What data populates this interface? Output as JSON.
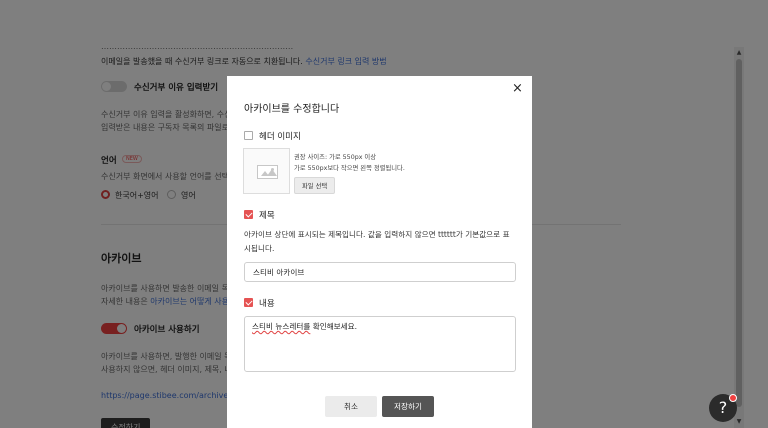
{
  "page": {
    "line_a": "이메일을 발송했을 때 수신거부 링크로 자동으로 치환됩니다.",
    "link_a": "수신거부 링크 입력 방법",
    "unsub_toggle_label": "수신거부 이유 입력받기",
    "unsub_desc_1": "수신거부 이유 입력을 활성화하면, 수신",
    "unsub_desc_2": "입력받은 내용은 구독자 목록의 파일로",
    "lang_heading": "언어",
    "new_badge": "NEW",
    "lang_desc": "수신거부 화면에서 사용할 언어를 선택",
    "lang_opt_1": "한국어+영어",
    "lang_opt_2": "영어",
    "archive_heading": "아카이브",
    "archive_desc_1": "아카이브를 사용하면 발송한 이메일 목",
    "archive_desc_2_pre": "자세한 내용은 ",
    "archive_desc_2_link": "아카이브는 어떻게 사용",
    "archive_toggle_label": "아카이브 사용하기",
    "archive_use_1": "아카이브를 사용하면, 발행한 이메일 목",
    "archive_use_2": "사용하지 않으면, 헤더 이미지, 제목, 내",
    "archive_url": "https://page.stibee.com/archive",
    "edit_button": "수정하기"
  },
  "modal": {
    "title": "아카이브를 수정합니다",
    "close_glyph": "×",
    "header_image": {
      "label": "헤더 이미지",
      "checked": false,
      "hint_1": "권장 사이즈: 가로 550px 이상",
      "hint_2": "가로 550px보다 작으면 왼쪽 정렬됩니다.",
      "file_button": "파일 선택"
    },
    "title_section": {
      "label": "제목",
      "checked": true,
      "desc": "아카이브 상단에 표시되는 제목입니다. 값을 입력하지 않으면 tttttt가 기본값으로 표시됩니다.",
      "input_value": "스티비 아카이브"
    },
    "content_section": {
      "label": "내용",
      "checked": true,
      "text_underlined": "스티비 뉴스레터를",
      "text_rest": " 확인해보세요."
    },
    "cancel_button": "취소",
    "save_button": "저장하기"
  },
  "help": {
    "glyph": "?"
  },
  "colors": {
    "accent": "#e55353",
    "overlay": "rgba(0,0,0,0.5)",
    "save_button": "#555555",
    "link": "#3d6fd8"
  }
}
